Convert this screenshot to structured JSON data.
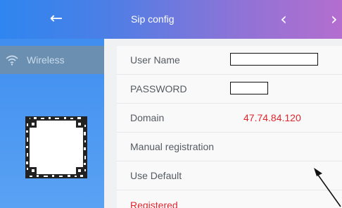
{
  "header": {
    "back_icon": "arrow-left-icon",
    "title": "Sip config",
    "prev_icon": "chevron-left-icon",
    "next_icon": "chevron-right-icon",
    "gradient_start": "#2f86f0",
    "gradient_end": "#b36ecf"
  },
  "sidebar": {
    "items": [
      {
        "label": "Wireless",
        "icon": "wifi-icon",
        "selected": true
      }
    ],
    "qr_icon": "qr-code-icon"
  },
  "form": {
    "rows": [
      {
        "label": "User Name",
        "value": ""
      },
      {
        "label": "PASSWORD",
        "value": ""
      },
      {
        "label": "Domain",
        "value": "47.74.84.120"
      },
      {
        "label": "Manual registration"
      },
      {
        "label": "Use Default"
      }
    ]
  },
  "status": {
    "text": "Registered",
    "color": "#e0262d"
  },
  "annotation": {
    "icon": "arrow-pointer-icon"
  }
}
